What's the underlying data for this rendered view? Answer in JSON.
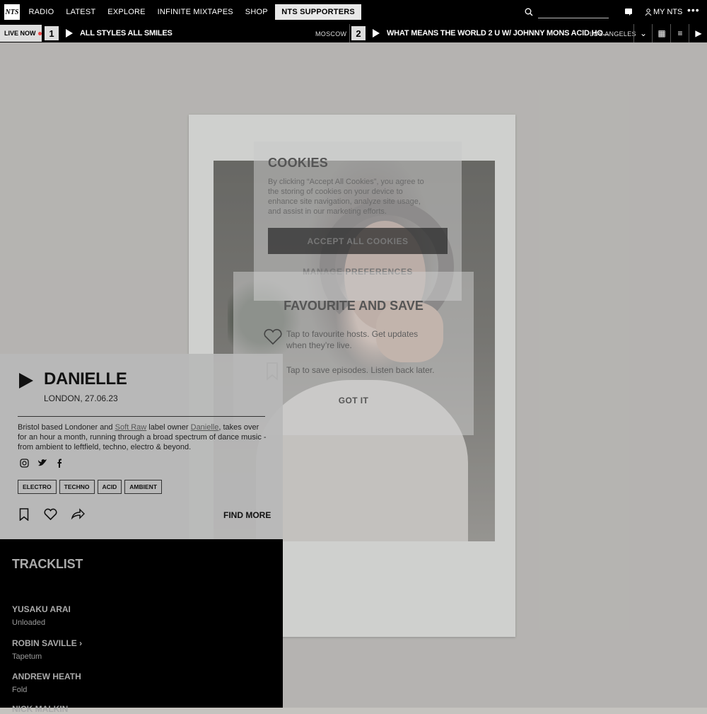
{
  "nav": {
    "logo": "NTS",
    "items": [
      "RADIO",
      "LATEST",
      "EXPLORE",
      "INFINITE MIXTAPES",
      "SHOP"
    ],
    "supporters": "NTS SUPPORTERS",
    "my_nts": "MY NTS"
  },
  "live": {
    "label": "LIVE NOW",
    "channels": [
      {
        "num": "1",
        "title": "ALL STYLES ALL SMILES",
        "location": "MOSCOW"
      },
      {
        "num": "2",
        "title": "WHAT MEANS THE WORLD 2 U W/ JOHNNY MONS ACID HO...",
        "location": "LOS ANGELES"
      }
    ]
  },
  "cookies": {
    "title": "COOKIES",
    "text": "By clicking “Accept All Cookies”, you agree to the storing of cookies on your device to enhance site navigation, analyze site usage, and assist in our marketing efforts.",
    "accept": "ACCEPT ALL COOKIES",
    "manage": "MANAGE PREFERENCES"
  },
  "favourite": {
    "title": "FAVOURITE AND SAVE",
    "fav_text": "Tap to favourite hosts. Get updates when they’re live.",
    "save_text": "Tap to save episodes. Listen back later.",
    "got_it": "GOT IT"
  },
  "episode": {
    "title": "DANIELLE",
    "meta": "LONDON, 27.06.23",
    "desc_1": "Bristol based Londoner and ",
    "link_1": "Soft Raw",
    "desc_2": " label owner ",
    "link_2": "Danielle",
    "desc_3": ", takes over for an hour a month, running through a broad spectrum of dance music - from ambient to leftfield, techno, electro & beyond.",
    "tags": [
      "ELECTRO",
      "TECHNO",
      "ACID",
      "AMBIENT"
    ],
    "find_more": "FIND MORE"
  },
  "tracklist": {
    "title": "TRACKLIST",
    "tracks": [
      {
        "artist": "YUSAKU ARAI",
        "title": "Unloaded"
      },
      {
        "artist": "ROBIN SAVILLE",
        "title": "Tapetum"
      },
      {
        "artist": "ANDREW HEATH",
        "title": "Fold"
      },
      {
        "artist": "NICK MALKIN",
        "title": ""
      }
    ]
  }
}
